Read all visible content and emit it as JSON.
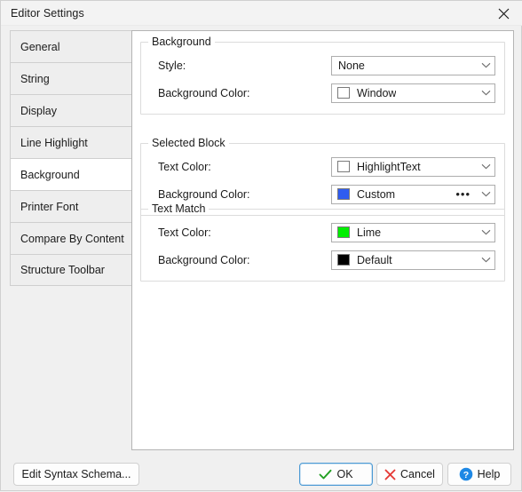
{
  "window": {
    "title": "Editor Settings",
    "close_icon": "close-icon"
  },
  "sidebar": {
    "items": [
      {
        "label": "General",
        "selected": false
      },
      {
        "label": "String",
        "selected": false
      },
      {
        "label": "Display",
        "selected": false
      },
      {
        "label": "Line Highlight",
        "selected": false
      },
      {
        "label": "Background",
        "selected": true
      },
      {
        "label": "Printer Font",
        "selected": false
      },
      {
        "label": "Compare By Content",
        "selected": false
      },
      {
        "label": "Structure Toolbar",
        "selected": false
      }
    ]
  },
  "groups": [
    {
      "title": "Background",
      "rows": [
        {
          "label": "Style:",
          "value": "None",
          "swatch": null,
          "has_ellipsis": false
        },
        {
          "label": "Background Color:",
          "value": "Window",
          "swatch": "#ffffff",
          "has_ellipsis": false
        }
      ]
    },
    {
      "title": "Selected Block",
      "rows": [
        {
          "label": "Text Color:",
          "value": "HighlightText",
          "swatch": "#ffffff",
          "has_ellipsis": false
        },
        {
          "label": "Background Color:",
          "value": "Custom",
          "swatch": "#2f5cf0",
          "has_ellipsis": true,
          "ellipsis_label": "•••"
        }
      ]
    },
    {
      "title": "Text Match",
      "rows": [
        {
          "label": "Text Color:",
          "value": "Lime",
          "swatch": "#00ee00",
          "has_ellipsis": false
        },
        {
          "label": "Background Color:",
          "value": "Default",
          "swatch": "#000000",
          "has_ellipsis": false
        }
      ]
    }
  ],
  "buttons": {
    "edit_syntax": "Edit Syntax Schema...",
    "ok": "OK",
    "cancel": "Cancel",
    "help": "Help"
  },
  "colors": {
    "accent_blue": "#0078d4",
    "check_green": "#22a022",
    "cancel_red": "#e53935",
    "help_blue": "#1e88e5",
    "selected_tab_bg": "#ffffff",
    "tab_bg": "#eeeeee"
  }
}
